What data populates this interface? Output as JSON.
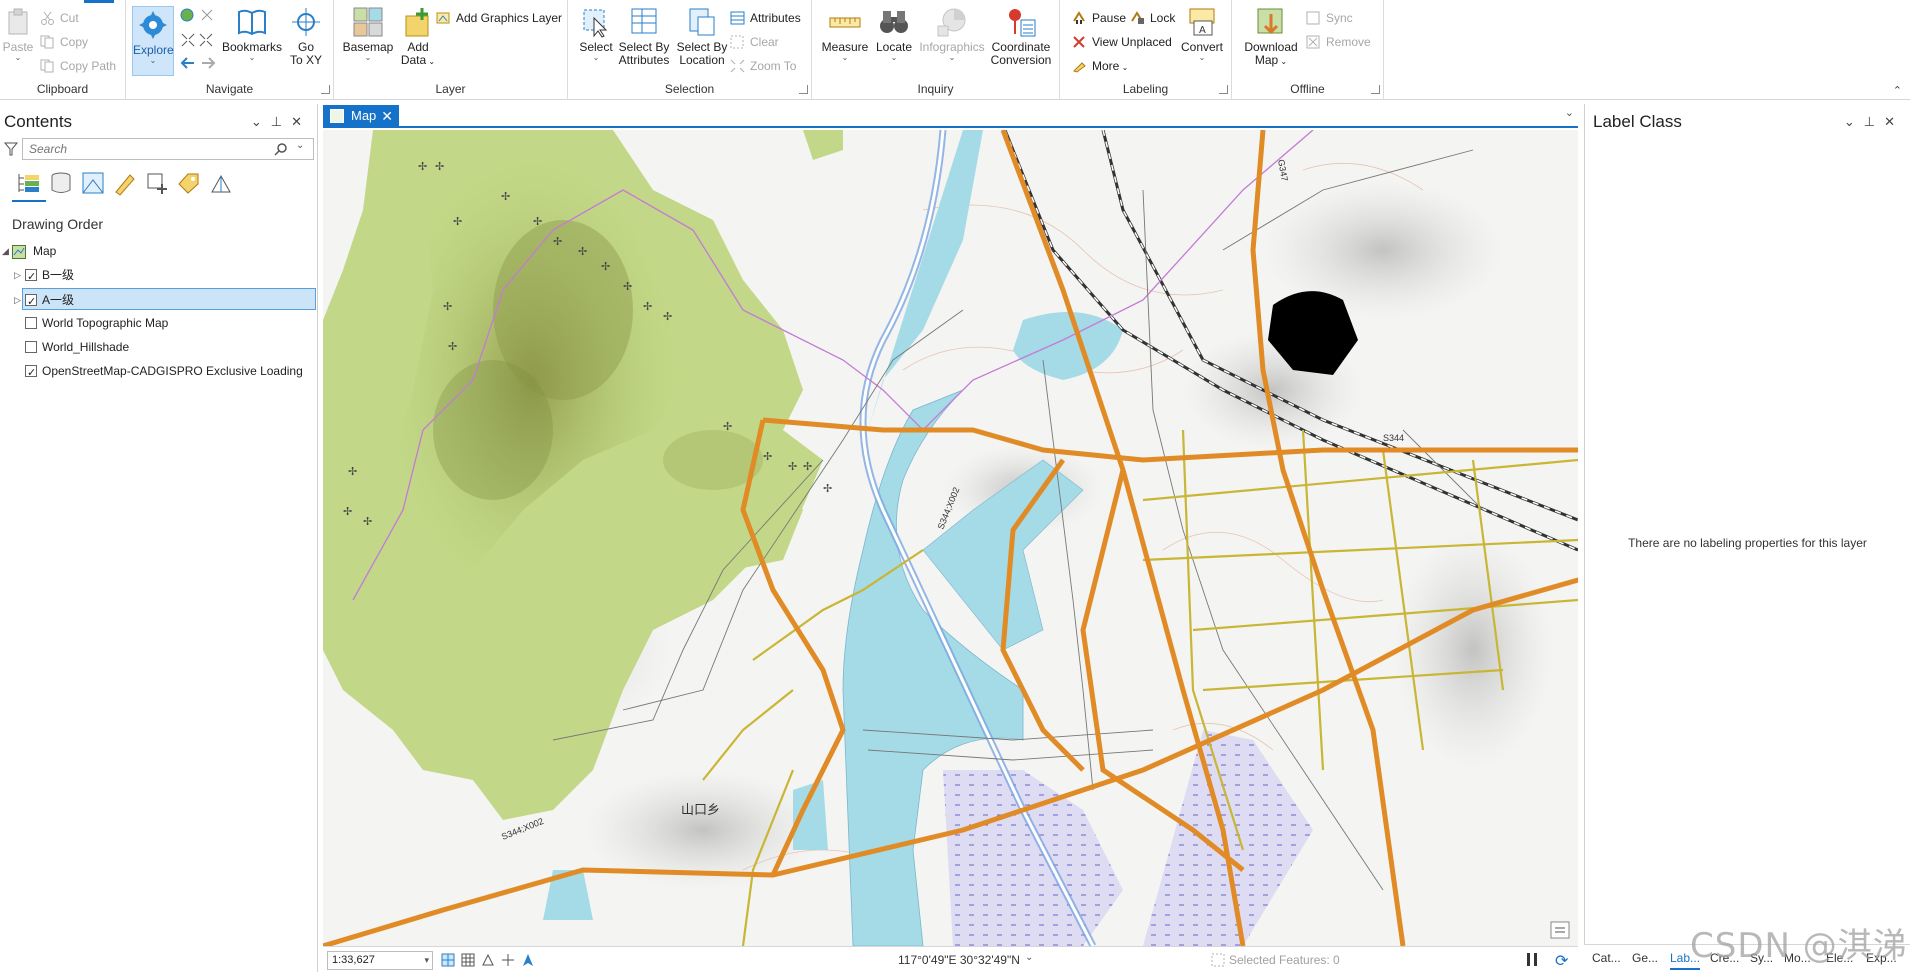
{
  "ribbon": {
    "clipboard": {
      "group_label": "Clipboard",
      "paste": "Paste",
      "cut": "Cut",
      "copy": "Copy",
      "copy_path": "Copy Path"
    },
    "navigate": {
      "group_label": "Navigate",
      "explore": "Explore",
      "bookmarks": "Bookmarks",
      "go_to_xy_line1": "Go",
      "go_to_xy_line2": "To XY"
    },
    "layer": {
      "group_label": "Layer",
      "basemap": "Basemap",
      "add_data_line1": "Add",
      "add_data_line2": "Data",
      "add_graphics_layer": "Add Graphics Layer"
    },
    "selection": {
      "group_label": "Selection",
      "select": "Select",
      "select_by_attributes_line1": "Select By",
      "select_by_attributes_line2": "Attributes",
      "select_by_location_line1": "Select By",
      "select_by_location_line2": "Location",
      "attributes": "Attributes",
      "clear": "Clear",
      "zoom_to": "Zoom To"
    },
    "inquiry": {
      "group_label": "Inquiry",
      "measure": "Measure",
      "locate": "Locate",
      "infographics": "Infographics",
      "coordinate_conversion_line1": "Coordinate",
      "coordinate_conversion_line2": "Conversion"
    },
    "labeling": {
      "group_label": "Labeling",
      "pause": "Pause",
      "lock": "Lock",
      "view_unplaced": "View Unplaced",
      "more": "More",
      "convert": "Convert"
    },
    "offline": {
      "group_label": "Offline",
      "download_map_line1": "Download",
      "download_map_line2": "Map",
      "sync": "Sync",
      "remove": "Remove"
    }
  },
  "contents": {
    "title": "Contents",
    "search_placeholder": "Search",
    "drawing_order": "Drawing Order",
    "map_name": "Map",
    "layers": [
      {
        "name": "B一级",
        "checked": true,
        "expandable": true,
        "selected": false
      },
      {
        "name": "A一级",
        "checked": true,
        "expandable": true,
        "selected": true
      },
      {
        "name": "World Topographic Map",
        "checked": false,
        "expandable": false,
        "selected": false
      },
      {
        "name": "World_Hillshade",
        "checked": false,
        "expandable": false,
        "selected": false
      },
      {
        "name": "OpenStreetMap-CADGISPRO Exclusive Loading",
        "checked": true,
        "expandable": false,
        "selected": false
      }
    ]
  },
  "map": {
    "tab_label": "Map",
    "road_labels": [
      "S344",
      "S344;X002",
      "S344;X002",
      "G347"
    ],
    "place_label": "山口乡",
    "scale": "1:33,627",
    "coordinates": "117°0'49\"E 30°32'49\"N",
    "selected_features": "Selected Features: 0"
  },
  "label_pane": {
    "title": "Label Class",
    "message": "There are no labeling properties for this layer"
  },
  "bottom_tabs": [
    "Cat...",
    "Ge...",
    "Lab...",
    "Cre...",
    "Sy...",
    "Mo...",
    "Ele...",
    "Exp..."
  ],
  "watermark": "CSDN @淇涕",
  "colors": {
    "accent": "#1672c9",
    "water": "#a4dbe7",
    "forest": "#b8d27a",
    "highway": "#e8902c"
  }
}
